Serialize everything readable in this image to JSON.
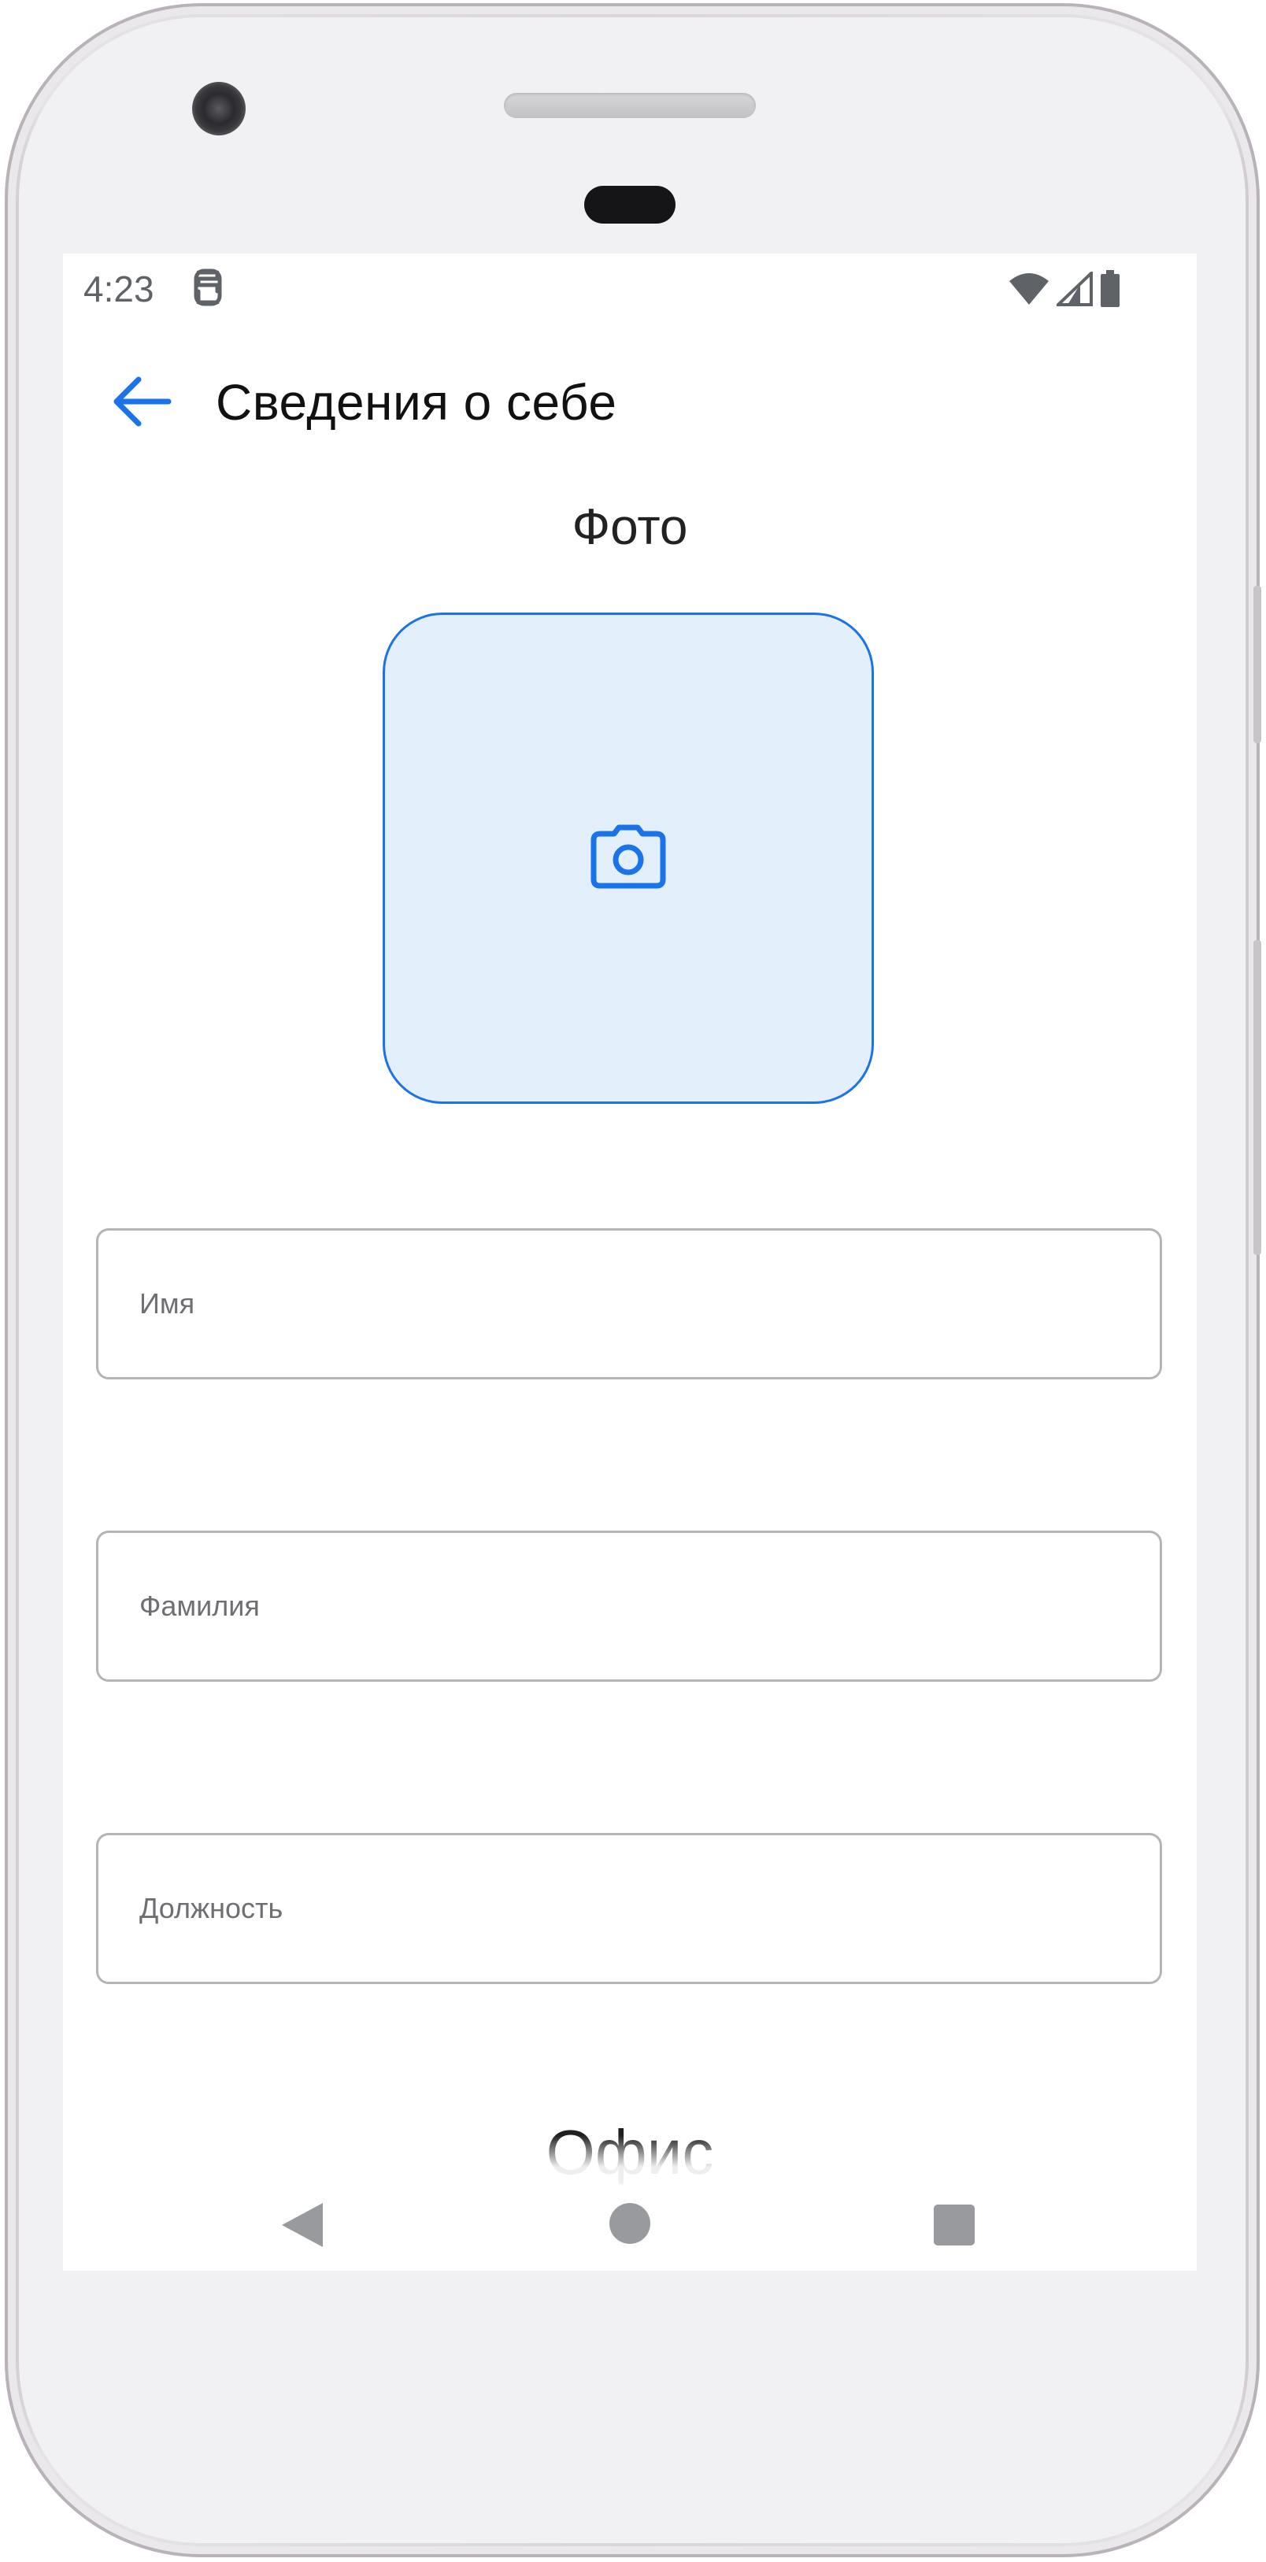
{
  "status_bar": {
    "time": "4:23",
    "left_icon": "sim-card-icon",
    "right_icons": [
      "wifi-icon",
      "cell-signal-icon",
      "battery-icon"
    ]
  },
  "app_bar": {
    "back_icon": "arrow-left-icon",
    "title": "Сведения о себе"
  },
  "photo": {
    "label": "Фото",
    "icon": "camera-icon"
  },
  "form": {
    "first_name_placeholder": "Имя",
    "last_name_placeholder": "Фамилия",
    "position_placeholder": "Должность"
  },
  "next_section": {
    "label": "Офис"
  },
  "colors": {
    "accent": "#1a73e8",
    "photo_background": "#e3f0fb",
    "field_border": "#b5b5b8"
  },
  "nav_bar": {
    "icons": [
      "nav-back-icon",
      "nav-home-icon",
      "nav-recents-icon"
    ]
  }
}
